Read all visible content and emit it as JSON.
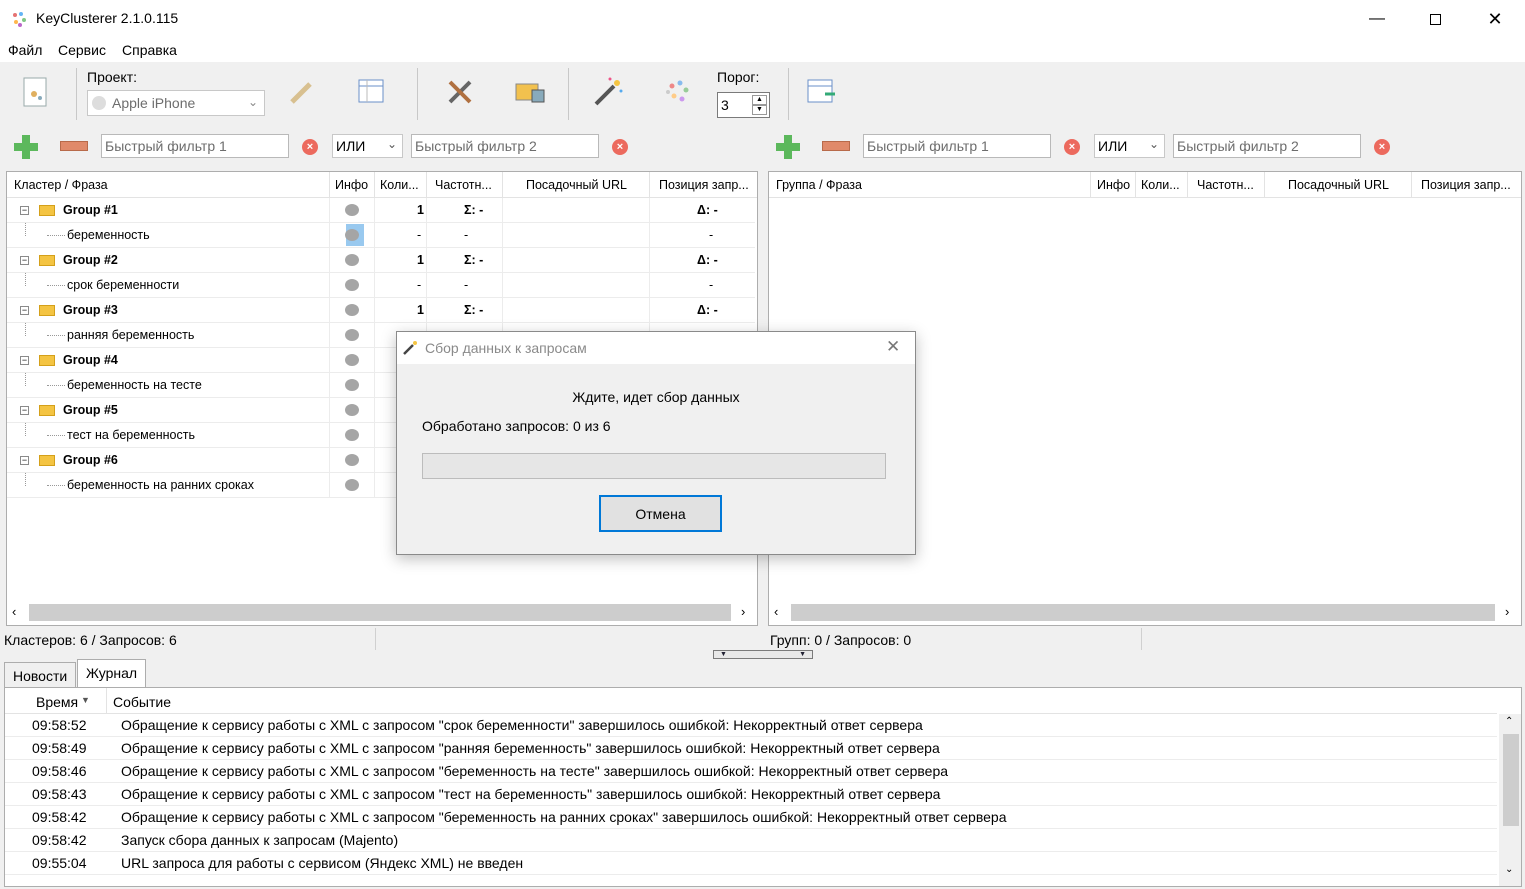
{
  "window": {
    "title": "KeyClusterer 2.1.0.115"
  },
  "menu": [
    "Файл",
    "Сервис",
    "Справка"
  ],
  "toolbar": {
    "project_label": "Проект:",
    "project_value": "Apple iPhone",
    "threshold_label": "Порог:",
    "threshold_value": "3"
  },
  "left_filter": {
    "filter1_placeholder": "Быстрый фильтр 1",
    "operator": "ИЛИ",
    "filter2_placeholder": "Быстрый фильтр 2"
  },
  "right_filter": {
    "filter1_placeholder": "Быстрый фильтр 1",
    "operator": "ИЛИ",
    "filter2_placeholder": "Быстрый фильтр 2"
  },
  "left_table": {
    "headers": [
      "Кластер / Фраза",
      "Инфо",
      "Коли...",
      "Частотн...",
      "Посадочный URL",
      "Позиция запр..."
    ],
    "groups": [
      {
        "name": "Group #1",
        "count": "1",
        "freq": "Σ: -",
        "pos": "Δ: -",
        "phrase": "беременность",
        "pcount": "-",
        "pfreq": "-",
        "ppos": "-"
      },
      {
        "name": "Group #2",
        "count": "1",
        "freq": "Σ: -",
        "pos": "Δ: -",
        "phrase": "срок беременности",
        "pcount": "-",
        "pfreq": "-",
        "ppos": "-"
      },
      {
        "name": "Group #3",
        "count": "1",
        "freq": "Σ: -",
        "pos": "Δ: -",
        "phrase": "ранняя беременность"
      },
      {
        "name": "Group #4",
        "phrase": "беременность на тесте"
      },
      {
        "name": "Group #5",
        "phrase": "тест на беременность"
      },
      {
        "name": "Group #6",
        "phrase": "беременность на ранних сроках"
      }
    ],
    "status": "Кластеров: 6 / Запросов: 6"
  },
  "right_table": {
    "headers": [
      "Группа / Фраза",
      "Инфо",
      "Коли...",
      "Частотн...",
      "Посадочный URL",
      "Позиция запр..."
    ],
    "status": "Групп: 0 / Запросов: 0"
  },
  "tabs": [
    "Новости",
    "Журнал"
  ],
  "log": {
    "headers": [
      "Время",
      "Событие"
    ],
    "rows": [
      {
        "time": "09:58:52",
        "event": "Обращение к сервису работы с XML с запросом \"срок беременности\" завершилось ошибкой: Некорректный ответ сервера"
      },
      {
        "time": "09:58:49",
        "event": "Обращение к сервису работы с XML с запросом \"ранняя беременность\" завершилось ошибкой: Некорректный ответ сервера"
      },
      {
        "time": "09:58:46",
        "event": "Обращение к сервису работы с XML с запросом \"беременность на тесте\" завершилось ошибкой: Некорректный ответ сервера"
      },
      {
        "time": "09:58:43",
        "event": "Обращение к сервису работы с XML с запросом \"тест на беременность\" завершилось ошибкой: Некорректный ответ сервера"
      },
      {
        "time": "09:58:42",
        "event": "Обращение к сервису работы с XML с запросом \"беременность на ранних сроках\" завершилось ошибкой: Некорректный ответ сервера"
      },
      {
        "time": "09:58:42",
        "event": "Запуск сбора данных к запросам (Majento)"
      },
      {
        "time": "09:55:04",
        "event": "URL запроса для работы с сервисом (Яндекс XML) не введен"
      }
    ]
  },
  "dialog": {
    "title": "Сбор данных к запросам",
    "message": "Ждите, идет сбор данных",
    "progress_text": "Обработано запросов: 0 из 6",
    "progress": 0,
    "cancel_label": "Отмена"
  }
}
